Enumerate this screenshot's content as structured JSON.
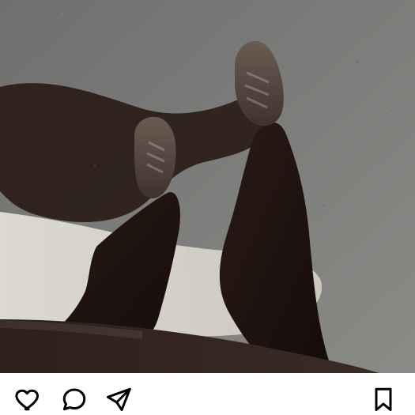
{
  "post": {
    "image_description_icon": "photo",
    "actions": {
      "like_icon": "heart-icon",
      "comment_icon": "comment-icon",
      "share_icon": "send-icon",
      "save_icon": "bookmark-icon"
    }
  }
}
